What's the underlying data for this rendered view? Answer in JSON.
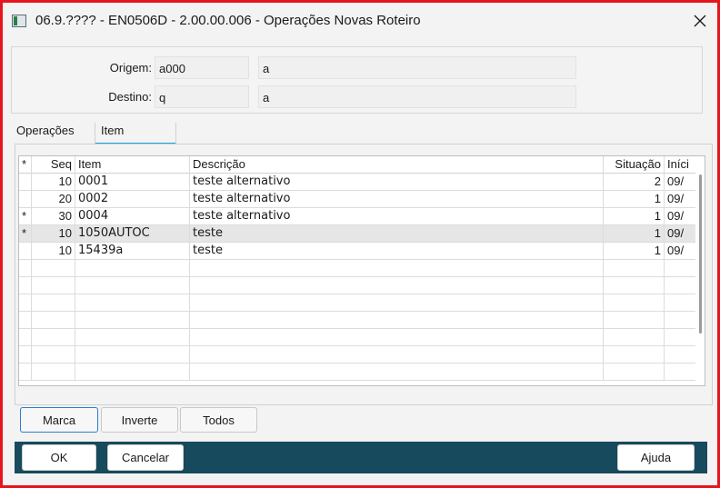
{
  "window": {
    "title": "06.9.???? - EN0506D - 2.00.00.006 - Operações Novas Roteiro",
    "close_label": "✕"
  },
  "header": {
    "origem_label": "Origem:",
    "origem_code": "a000",
    "origem_desc": "a",
    "destino_label": "Destino:",
    "destino_code": "q",
    "destino_desc": "a"
  },
  "tabs": [
    {
      "label": "Operações",
      "active": false
    },
    {
      "label": "Item",
      "active": true
    }
  ],
  "grid": {
    "columns": [
      "*",
      "Seq",
      "Item",
      "Descrição",
      "Situação",
      "Iníci"
    ],
    "rows": [
      {
        "mark": "",
        "seq": "10",
        "item": "0001",
        "descricao": "teste alternativo",
        "situacao": "2",
        "inicio": "09/"
      },
      {
        "mark": "",
        "seq": "20",
        "item": "0002",
        "descricao": "teste alternativo",
        "situacao": "1",
        "inicio": "09/"
      },
      {
        "mark": "*",
        "seq": "30",
        "item": "0004",
        "descricao": "teste alternativo",
        "situacao": "1",
        "inicio": "09/"
      },
      {
        "mark": "*",
        "seq": "10",
        "item": "1050AUTOC",
        "descricao": "teste",
        "situacao": "1",
        "inicio": "09/",
        "selected": true
      },
      {
        "mark": "",
        "seq": "10",
        "item": "15439a",
        "descricao": "teste",
        "situacao": "1",
        "inicio": "09/"
      }
    ]
  },
  "actions": {
    "marca": "Marca",
    "inverte": "Inverte",
    "todos": "Todos"
  },
  "footer": {
    "ok": "OK",
    "cancelar": "Cancelar",
    "ajuda": "Ajuda"
  },
  "colors": {
    "window_border": "#e8141c",
    "footer_bar": "#174a5c",
    "tab_accent": "#1aa3e0",
    "focus_border": "#2b7fd0"
  }
}
